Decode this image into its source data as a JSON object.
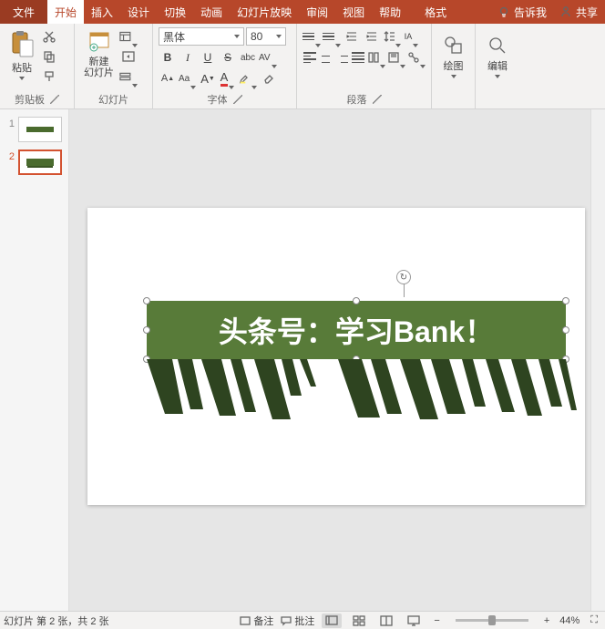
{
  "tabs": {
    "file": "文件",
    "home": "开始",
    "insert": "插入",
    "design": "设计",
    "transition": "切换",
    "animation": "动画",
    "slideshow": "幻灯片放映",
    "review": "审阅",
    "view": "视图",
    "help": "帮助",
    "format": "格式",
    "tellme": "告诉我",
    "share": "共享"
  },
  "ribbon": {
    "clipboard": {
      "label": "剪贴板",
      "paste": "粘贴"
    },
    "slides": {
      "label": "幻灯片",
      "new": "新建\n幻灯片"
    },
    "font": {
      "label": "字体",
      "name": "黑体",
      "size": "80"
    },
    "paragraph": {
      "label": "段落"
    },
    "drawing": {
      "label": "绘图",
      "btn": "绘图"
    },
    "editing": {
      "label": "编辑",
      "btn": "编辑"
    }
  },
  "thumbs": [
    {
      "num": "1"
    },
    {
      "num": "2"
    }
  ],
  "slide": {
    "text": "头条号：学习Bank！"
  },
  "status": {
    "slideInfo": "幻灯片 第 2 张，共 2 张",
    "notes": "备注",
    "comments": "批注",
    "zoom": "44%",
    "plus": "+",
    "minus": "−",
    "fit": "⛶"
  }
}
